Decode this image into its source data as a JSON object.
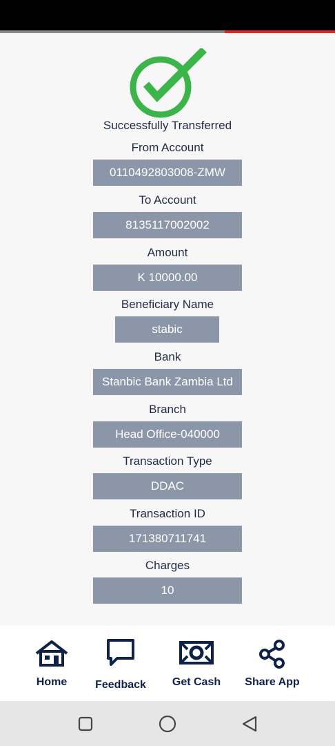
{
  "colors": {
    "accent_red": "#d82b30",
    "success_green": "#3bb54a",
    "value_box_bg": "#8b97a8",
    "text_dark": "#1f2a44",
    "nav_blue": "#0e2149"
  },
  "progress": {
    "fraction": 0.33
  },
  "status": {
    "message": "Successfully Transferred",
    "icon": "check-circle-icon"
  },
  "details": [
    {
      "label": "From Account",
      "value": "0110492803008-ZMW"
    },
    {
      "label": "To Account",
      "value": "8135117002002"
    },
    {
      "label": "Amount",
      "value": "K 10000.00"
    },
    {
      "label": "Beneficiary Name",
      "value": "stabic"
    },
    {
      "label": "Bank",
      "value": "Stanbic Bank Zambia Ltd"
    },
    {
      "label": "Branch",
      "value": "Head Office-040000"
    },
    {
      "label": "Transaction Type",
      "value": "DDAC"
    },
    {
      "label": "Transaction ID",
      "value": "171380711741"
    },
    {
      "label": "Charges",
      "value": "10"
    }
  ],
  "bottom_nav": [
    {
      "label": "Home",
      "icon": "home-icon"
    },
    {
      "label": "Feedback",
      "icon": "chat-bubble-icon"
    },
    {
      "label": "Get Cash",
      "icon": "cash-note-icon"
    },
    {
      "label": "Share App",
      "icon": "share-icon"
    }
  ],
  "system_nav": [
    {
      "icon": "recents-square-icon"
    },
    {
      "icon": "home-circle-icon"
    },
    {
      "icon": "back-triangle-icon"
    }
  ]
}
